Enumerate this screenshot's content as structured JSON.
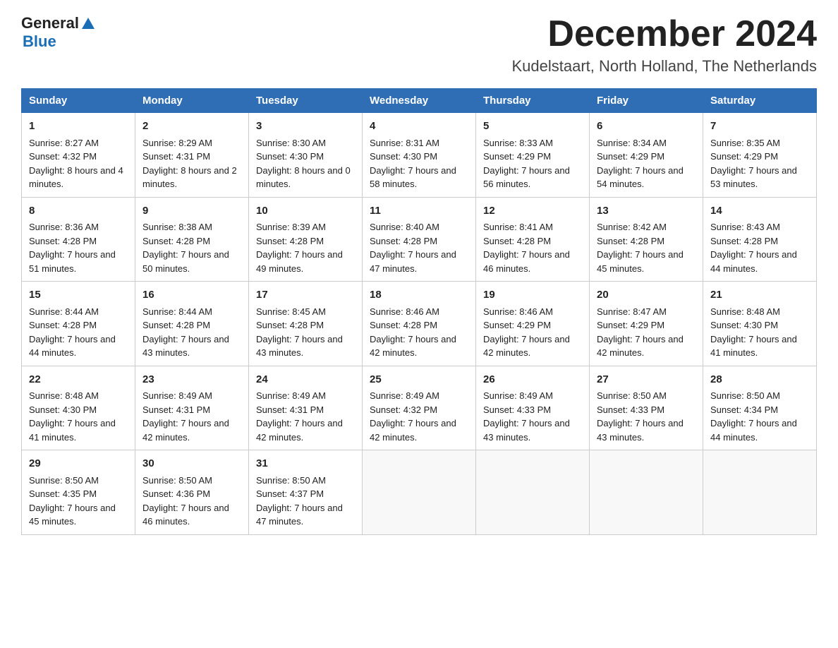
{
  "header": {
    "logo_general": "General",
    "logo_blue": "Blue",
    "calendar_title": "December 2024",
    "calendar_subtitle": "Kudelstaart, North Holland, The Netherlands"
  },
  "weekdays": [
    "Sunday",
    "Monday",
    "Tuesday",
    "Wednesday",
    "Thursday",
    "Friday",
    "Saturday"
  ],
  "weeks": [
    [
      {
        "day": "1",
        "sunrise": "8:27 AM",
        "sunset": "4:32 PM",
        "daylight": "8 hours and 4 minutes."
      },
      {
        "day": "2",
        "sunrise": "8:29 AM",
        "sunset": "4:31 PM",
        "daylight": "8 hours and 2 minutes."
      },
      {
        "day": "3",
        "sunrise": "8:30 AM",
        "sunset": "4:30 PM",
        "daylight": "8 hours and 0 minutes."
      },
      {
        "day": "4",
        "sunrise": "8:31 AM",
        "sunset": "4:30 PM",
        "daylight": "7 hours and 58 minutes."
      },
      {
        "day": "5",
        "sunrise": "8:33 AM",
        "sunset": "4:29 PM",
        "daylight": "7 hours and 56 minutes."
      },
      {
        "day": "6",
        "sunrise": "8:34 AM",
        "sunset": "4:29 PM",
        "daylight": "7 hours and 54 minutes."
      },
      {
        "day": "7",
        "sunrise": "8:35 AM",
        "sunset": "4:29 PM",
        "daylight": "7 hours and 53 minutes."
      }
    ],
    [
      {
        "day": "8",
        "sunrise": "8:36 AM",
        "sunset": "4:28 PM",
        "daylight": "7 hours and 51 minutes."
      },
      {
        "day": "9",
        "sunrise": "8:38 AM",
        "sunset": "4:28 PM",
        "daylight": "7 hours and 50 minutes."
      },
      {
        "day": "10",
        "sunrise": "8:39 AM",
        "sunset": "4:28 PM",
        "daylight": "7 hours and 49 minutes."
      },
      {
        "day": "11",
        "sunrise": "8:40 AM",
        "sunset": "4:28 PM",
        "daylight": "7 hours and 47 minutes."
      },
      {
        "day": "12",
        "sunrise": "8:41 AM",
        "sunset": "4:28 PM",
        "daylight": "7 hours and 46 minutes."
      },
      {
        "day": "13",
        "sunrise": "8:42 AM",
        "sunset": "4:28 PM",
        "daylight": "7 hours and 45 minutes."
      },
      {
        "day": "14",
        "sunrise": "8:43 AM",
        "sunset": "4:28 PM",
        "daylight": "7 hours and 44 minutes."
      }
    ],
    [
      {
        "day": "15",
        "sunrise": "8:44 AM",
        "sunset": "4:28 PM",
        "daylight": "7 hours and 44 minutes."
      },
      {
        "day": "16",
        "sunrise": "8:44 AM",
        "sunset": "4:28 PM",
        "daylight": "7 hours and 43 minutes."
      },
      {
        "day": "17",
        "sunrise": "8:45 AM",
        "sunset": "4:28 PM",
        "daylight": "7 hours and 43 minutes."
      },
      {
        "day": "18",
        "sunrise": "8:46 AM",
        "sunset": "4:28 PM",
        "daylight": "7 hours and 42 minutes."
      },
      {
        "day": "19",
        "sunrise": "8:46 AM",
        "sunset": "4:29 PM",
        "daylight": "7 hours and 42 minutes."
      },
      {
        "day": "20",
        "sunrise": "8:47 AM",
        "sunset": "4:29 PM",
        "daylight": "7 hours and 42 minutes."
      },
      {
        "day": "21",
        "sunrise": "8:48 AM",
        "sunset": "4:30 PM",
        "daylight": "7 hours and 41 minutes."
      }
    ],
    [
      {
        "day": "22",
        "sunrise": "8:48 AM",
        "sunset": "4:30 PM",
        "daylight": "7 hours and 41 minutes."
      },
      {
        "day": "23",
        "sunrise": "8:49 AM",
        "sunset": "4:31 PM",
        "daylight": "7 hours and 42 minutes."
      },
      {
        "day": "24",
        "sunrise": "8:49 AM",
        "sunset": "4:31 PM",
        "daylight": "7 hours and 42 minutes."
      },
      {
        "day": "25",
        "sunrise": "8:49 AM",
        "sunset": "4:32 PM",
        "daylight": "7 hours and 42 minutes."
      },
      {
        "day": "26",
        "sunrise": "8:49 AM",
        "sunset": "4:33 PM",
        "daylight": "7 hours and 43 minutes."
      },
      {
        "day": "27",
        "sunrise": "8:50 AM",
        "sunset": "4:33 PM",
        "daylight": "7 hours and 43 minutes."
      },
      {
        "day": "28",
        "sunrise": "8:50 AM",
        "sunset": "4:34 PM",
        "daylight": "7 hours and 44 minutes."
      }
    ],
    [
      {
        "day": "29",
        "sunrise": "8:50 AM",
        "sunset": "4:35 PM",
        "daylight": "7 hours and 45 minutes."
      },
      {
        "day": "30",
        "sunrise": "8:50 AM",
        "sunset": "4:36 PM",
        "daylight": "7 hours and 46 minutes."
      },
      {
        "day": "31",
        "sunrise": "8:50 AM",
        "sunset": "4:37 PM",
        "daylight": "7 hours and 47 minutes."
      },
      null,
      null,
      null,
      null
    ]
  ]
}
